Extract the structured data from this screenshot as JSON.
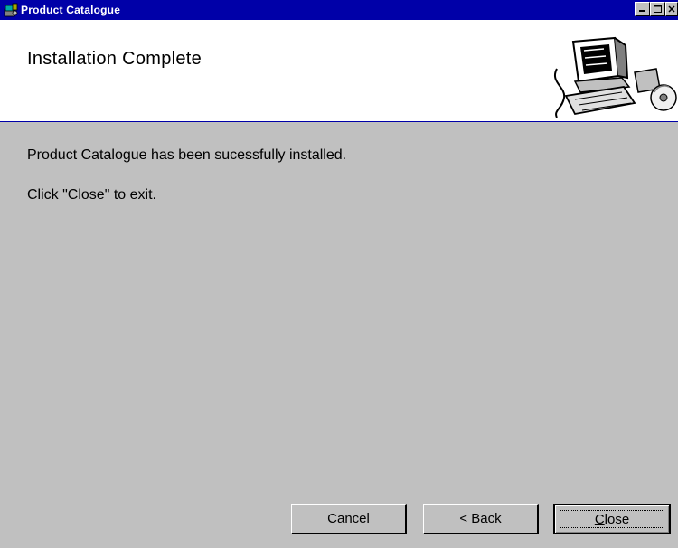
{
  "window": {
    "title": "Product Catalogue",
    "controls": {
      "minimize": "_",
      "maximize": "□",
      "close": "×"
    }
  },
  "header": {
    "title": "Installation Complete",
    "icon": "computer-illustration"
  },
  "content": {
    "message_line1": "Product Catalogue has been sucessfully installed.",
    "message_line2": "Click \"Close\" to exit."
  },
  "buttons": {
    "cancel": "Cancel",
    "back_prefix": "< ",
    "back_mnemonic": "B",
    "back_rest": "ack",
    "close_mnemonic": "C",
    "close_rest": "lose"
  },
  "colors": {
    "titlebar": "#0000a8",
    "dialog_face": "#c0c0c0",
    "header_bg": "#ffffff"
  }
}
